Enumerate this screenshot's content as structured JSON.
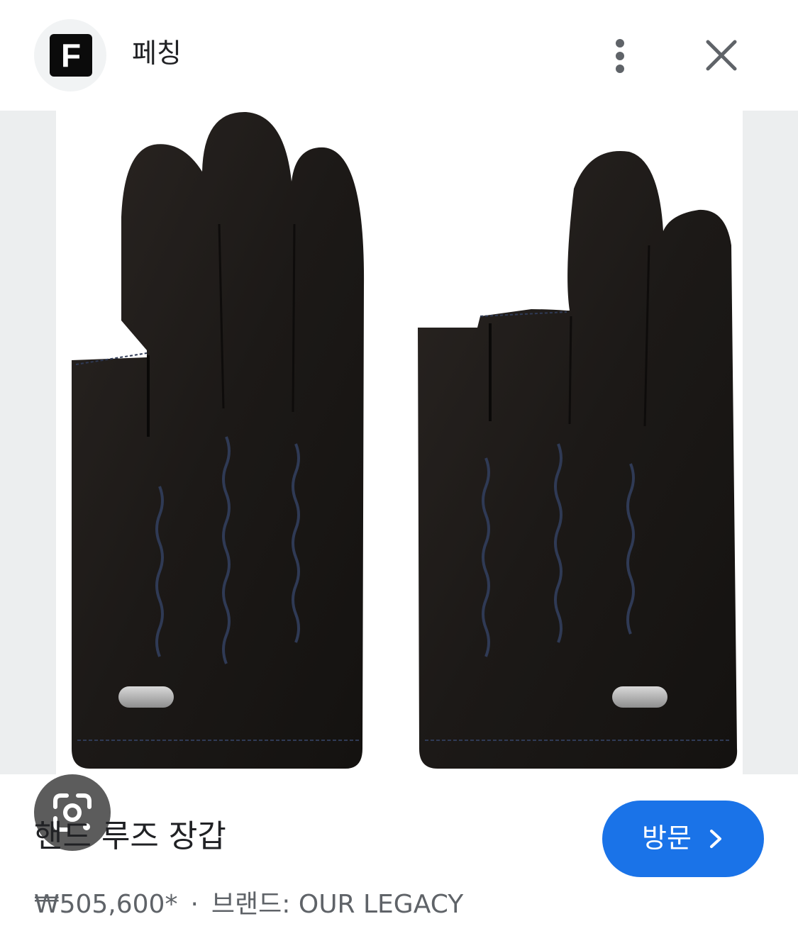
{
  "header": {
    "logo_letter": "F",
    "site_name": "페칭"
  },
  "icons": {
    "more": "more-vert-icon",
    "close": "close-icon",
    "lens": "google-lens-icon",
    "chevron": "chevron-right-icon"
  },
  "product": {
    "title": "핸드 루즈 장갑",
    "price": "₩505,600*",
    "separator": "·",
    "brand_label": "브랜드: OUR LEGACY",
    "visit_label": "방문"
  },
  "colors": {
    "accent": "#1a73e8",
    "glove": "#1b1816",
    "logo": "#0b0b0b"
  }
}
